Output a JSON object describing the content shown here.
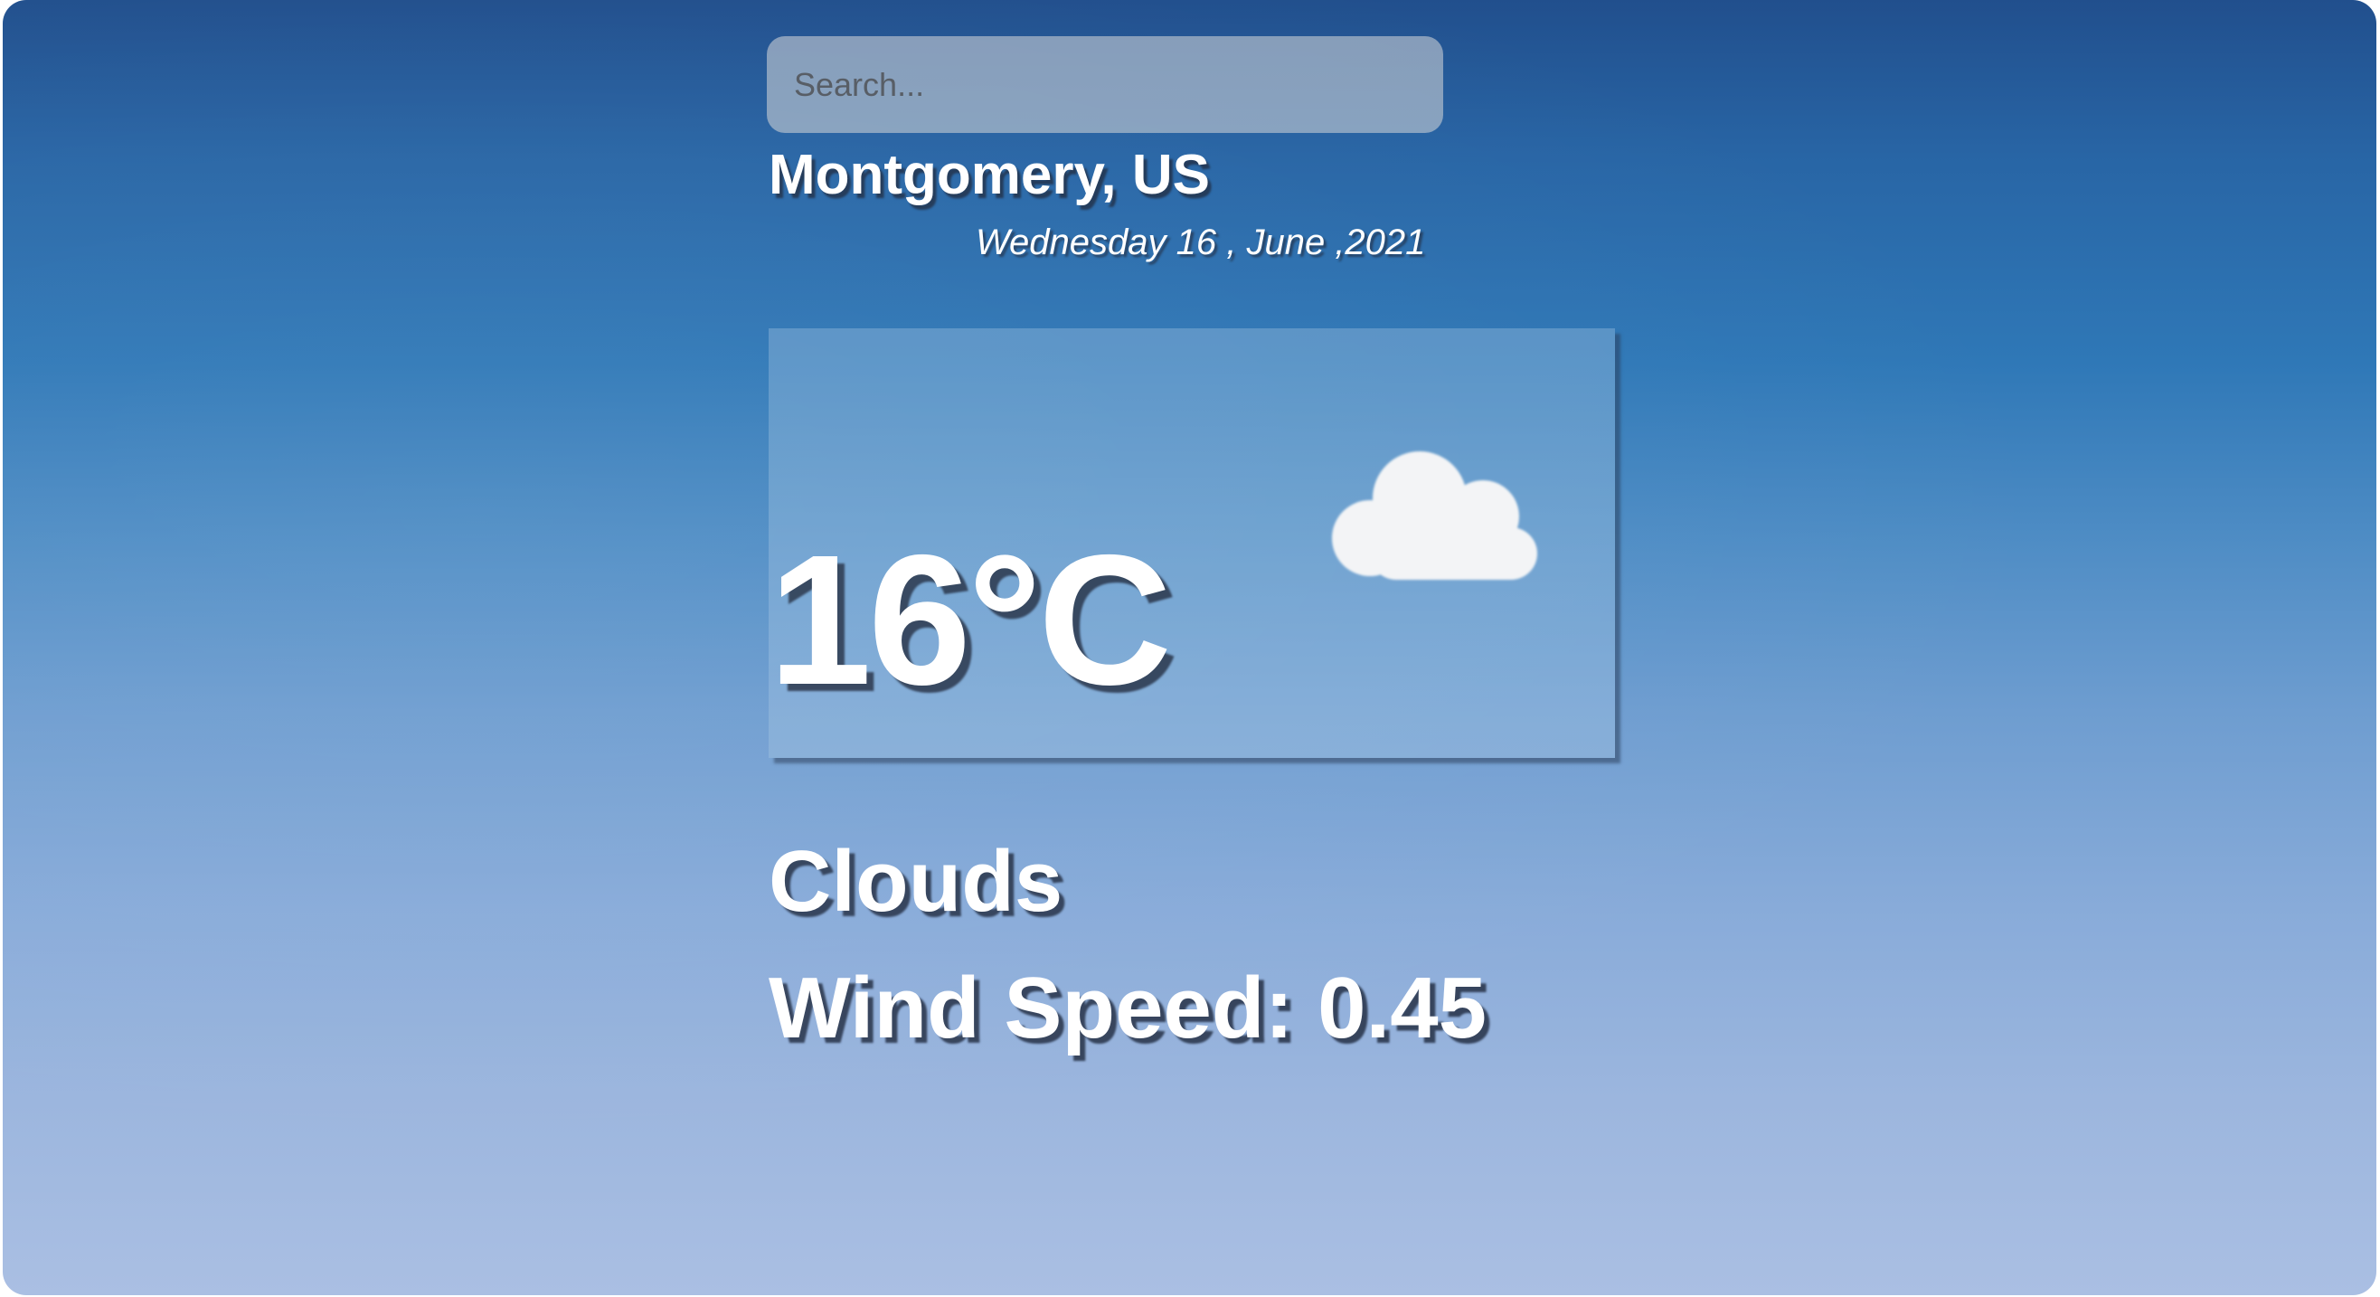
{
  "search": {
    "placeholder": "Search...",
    "value": ""
  },
  "location": {
    "label": "Montgomery, US"
  },
  "date": {
    "label": "Wednesday 16 , June ,2021"
  },
  "weather": {
    "temperature": "16°C",
    "icon": "cloud-icon",
    "condition": "Clouds",
    "wind_speed": "Wind Speed: 0.45"
  },
  "colors": {
    "background_top": "#214f8d",
    "background_bottom": "#aabfe3",
    "text": "#ffffff"
  }
}
